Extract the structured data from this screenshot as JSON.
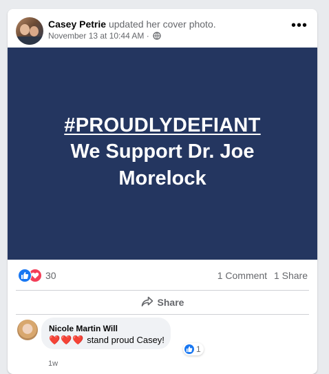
{
  "post": {
    "author": "Casey Petrie",
    "action": "updated her cover photo.",
    "timestamp": "November 13 at 10:44 AM",
    "separator": "·",
    "privacy_icon": "globe-icon",
    "more_label": "•••"
  },
  "cover": {
    "hashtag": "#PROUDLYDEFIANT",
    "text": "We Support Dr. Joe Morelock",
    "background": "#243660"
  },
  "stats": {
    "reaction_icons": [
      "like-icon",
      "love-icon"
    ],
    "reaction_count": "30",
    "comments": "1 Comment",
    "shares": "1 Share"
  },
  "actions": {
    "share_label": "Share",
    "share_icon": "share-arrow-icon"
  },
  "comment": {
    "author": "Nicole Martin Will",
    "hearts": "❤️❤️❤️",
    "text": "stand proud Casey!",
    "reaction_icon": "like-icon",
    "reaction_count": "1",
    "time": "1w"
  },
  "colors": {
    "accent": "#1877f2",
    "love": "#f33e58",
    "secondary_text": "#65676b"
  }
}
